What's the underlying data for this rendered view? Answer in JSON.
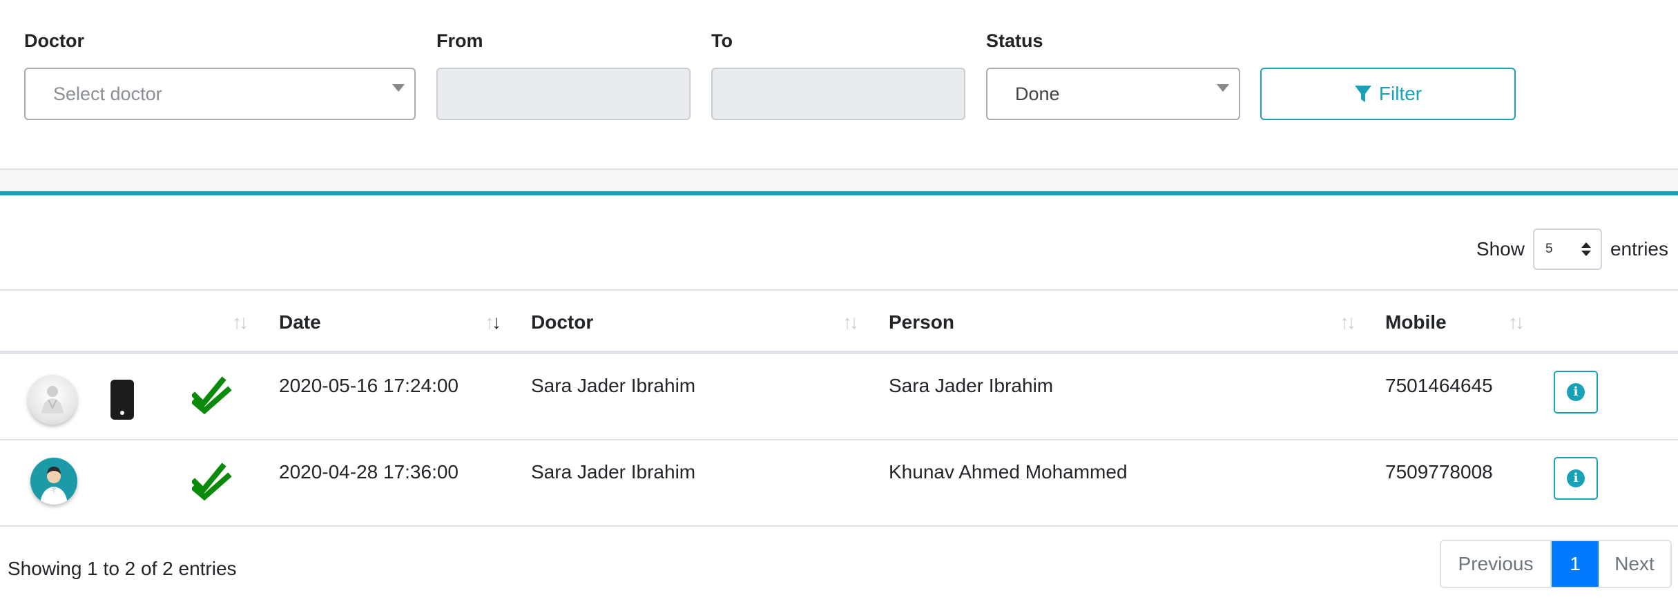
{
  "filters": {
    "doctor_label": "Doctor",
    "doctor_placeholder": "Select doctor",
    "from_label": "From",
    "from_value": "",
    "to_label": "To",
    "to_value": "",
    "status_label": "Status",
    "status_value": "Done",
    "filter_button": "Filter"
  },
  "length": {
    "show": "Show",
    "value": "5",
    "entries": "entries"
  },
  "columns": [
    "",
    "Date",
    "Doctor",
    "Person",
    "Mobile"
  ],
  "rows": [
    {
      "avatar": "doctor-avatar-grey",
      "device": "mobile-phone-icon",
      "status_icon": "double-check-icon",
      "date": "2020-05-16 17:24:00",
      "doctor": "Sara Jader Ibrahim",
      "person": "Sara Jader Ibrahim",
      "mobile": "7501464645"
    },
    {
      "avatar": "doctor-avatar-teal",
      "device": "",
      "status_icon": "double-check-icon",
      "date": "2020-04-28 17:36:00",
      "doctor": "Sara Jader Ibrahim",
      "person": "Khunav Ahmed Mohammed",
      "mobile": "7509778008"
    }
  ],
  "footer": {
    "info": "Showing 1 to 2 of 2 entries",
    "previous": "Previous",
    "current_page": "1",
    "next": "Next"
  },
  "colors": {
    "accent": "#17a2b8",
    "check": "#0a8a0a",
    "page_active": "#007bff"
  }
}
